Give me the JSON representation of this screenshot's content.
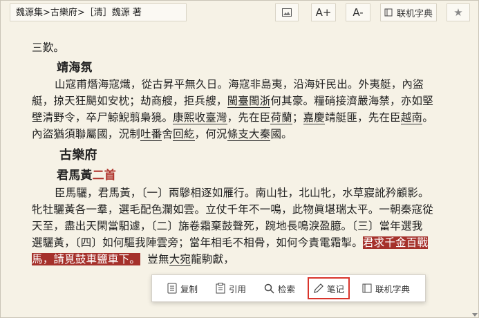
{
  "toolbar": {
    "breadcrumb": "魏源集>古樂府>［清］魏源 著",
    "image_button_icon": "image-icon",
    "font_increase_label": "A+",
    "font_decrease_label": "A-",
    "dictionary_label": "联机字典",
    "favorite_icon": "star-icon"
  },
  "content": {
    "line1": "三歎。",
    "title1": "靖海氛",
    "p1": [
      "山寇甫熸海寇熾，從古昇平無久日。海寇非島夷，沿海奸民出。外夷艇，內盜",
      "艇，掠天狂颶如安枕；劫商艘，拒兵艘，",
      "閩臺閩浙",
      "何其豪。糧硝接濟嚴海禁，亦如堅",
      "壁清野令，卒尸鯨鯢翦梟獍。",
      "康熙收臺灣",
      "，先在臣",
      "荷蘭",
      "；",
      "嘉慶",
      "靖艇匪，先在臣",
      "越南",
      "。",
      "內盜猶須聯屬國，況制",
      "吐番",
      "舍",
      "回紇",
      "，何況",
      "條支",
      "大秦",
      "國。"
    ],
    "section": "古樂府",
    "title2_a": "君馬黃",
    "title2_b": "二首",
    "p2": [
      "臣馬驪，君馬黃，〔一〕兩驂相逐如雁行。南山牡，北山牝，水草寢訛矜顧影。",
      "牝牡驪黃各一羣，選毛配色瀾如雲。立仗千年不一鳴，此物眞堪瑞太平。一朝秦寇從",
      "天至，盡出天閑當馹遽，〔二〕旆卷霜棄鼓聲死，踠地長鳴淚盈臆。〔三〕當年選我",
      "選驪黃，〔四〕如何驅我陣雲旁；當年相毛不相骨，如何今責電霜掣。",
      "君求千金百戰",
      "馬，請覓鼓車鹽車下。",
      "豈無",
      "大宛",
      "龍駒獻，"
    ]
  },
  "popup": {
    "copy": "复制",
    "cite": "引用",
    "search": "检索",
    "note": "笔记",
    "dict": "联机字典"
  },
  "colors": {
    "highlight": "#a5312b",
    "accent_red": "#d9342b",
    "background": "#f6f2e6"
  }
}
